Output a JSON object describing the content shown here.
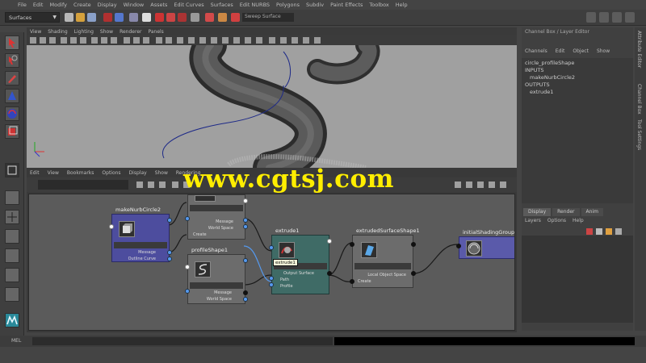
{
  "menubar": {
    "items": [
      "File",
      "Edit",
      "Modify",
      "Create",
      "Display",
      "Window",
      "Assets",
      "Edit Curves",
      "Surfaces",
      "Edit NURBS",
      "Polygons",
      "Subdiv",
      "Paint Effects",
      "Toolbox",
      "Help"
    ]
  },
  "toolbar": {
    "mode_select": "Surfaces",
    "search_field": "Sweep Surface"
  },
  "viewport": {
    "menu": [
      "View",
      "Shading",
      "Lighting",
      "Show",
      "Renderer",
      "Panels"
    ]
  },
  "hypergraph": {
    "menu": [
      "Edit",
      "View",
      "Bookmarks",
      "Options",
      "Display",
      "Show",
      "Rendering"
    ],
    "nodes": {
      "make_nurb_circle": {
        "title": "makeNurbCircle2",
        "plug_message": "Message",
        "plug_output": "Outline Curve"
      },
      "circle_shape_top": {
        "plug_message": "Message",
        "plug_world": "World Space",
        "plug_create": "Create"
      },
      "profile_shape": {
        "title": "profileShape1",
        "plug_message": "Message",
        "plug_world": "World Space"
      },
      "extrude": {
        "title": "extrude1",
        "tooltip": "extrude1",
        "plug_output": "Output Surface",
        "plug_path": "Path",
        "plug_profile": "Profile"
      },
      "nurbs_shape": {
        "title": "extrudedSurfaceShape1",
        "plug_out": "Local Object Space",
        "plug_create": "Create"
      },
      "shading_group": {
        "title": "initialShadingGroup"
      }
    }
  },
  "channel_box": {
    "title": "Channel Box / Layer Editor",
    "tabs": [
      "Channels",
      "Edit",
      "Object",
      "Show"
    ],
    "lines": [
      "circle_profileShape",
      "INPUTS",
      "makeNurbCircle2",
      "OUTPUTS",
      "extrude1"
    ]
  },
  "layer_editor": {
    "tabs": [
      "Display",
      "Render",
      "Anim"
    ],
    "menu": [
      "Layers",
      "Options",
      "Help"
    ]
  },
  "side_tabs": [
    "Attribute Editor",
    "Channel Box",
    "Tool Settings"
  ],
  "command_line": {
    "label": "MEL"
  },
  "watermark": {
    "text": "www.cgtsj.com"
  },
  "colors": {
    "accent_port": "#5599ee",
    "watermark": "#ffee00",
    "shading_node": "#5a5aaa",
    "extrude_node": "#3f6b66"
  }
}
